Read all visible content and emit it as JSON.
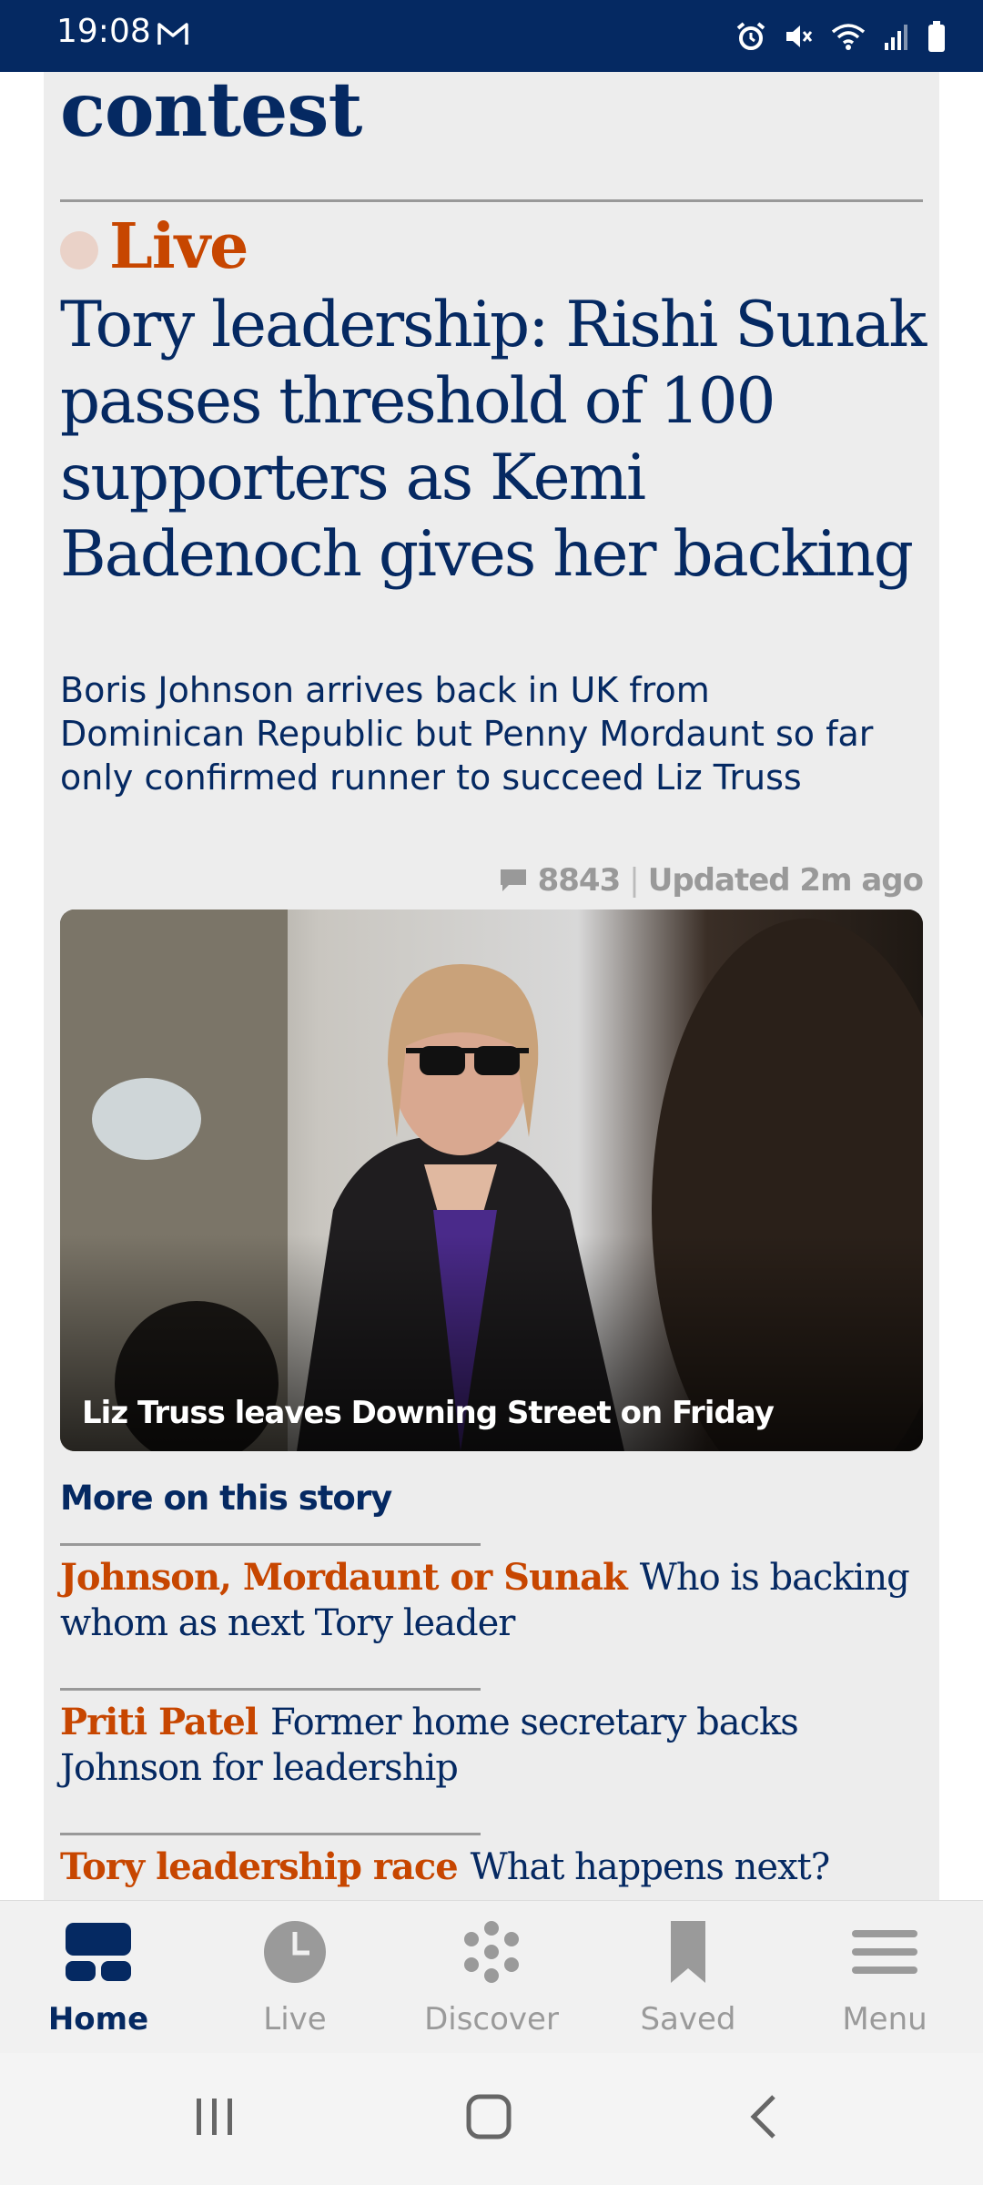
{
  "status_bar": {
    "time": "19:08",
    "icons": [
      "gmail-icon",
      "alarm-icon",
      "mute-icon",
      "wifi-icon",
      "signal-icon",
      "battery-icon"
    ]
  },
  "article": {
    "headline_fragment": "contest",
    "live_label": "Live",
    "headline": "Tory leadership: Rishi Sunak passes threshold of 100 supporters as Kemi Badenoch gives her backing",
    "standfirst": "Boris Johnson arrives back in UK from Dominican Republic but Penny Mordaunt so far only confirmed runner to succeed Liz Truss",
    "comment_count": "8843",
    "separator": "|",
    "updated": "Updated 2m ago",
    "image_caption": "Liz Truss leaves Downing Street on Friday"
  },
  "more_on_story": {
    "title": "More on this story",
    "items": [
      {
        "kicker": "Johnson, Mordaunt or Sunak",
        "text": "Who is backing whom as next Tory leader"
      },
      {
        "kicker": "Priti Patel",
        "text": "Former home secretary backs Johnson for leadership"
      },
      {
        "kicker": "Tory leadership race",
        "text": "What happens next?"
      }
    ]
  },
  "bottom_nav": {
    "items": [
      {
        "label": "Home",
        "icon": "home-icon",
        "active": true
      },
      {
        "label": "Live",
        "icon": "clock-icon",
        "active": false
      },
      {
        "label": "Discover",
        "icon": "discover-icon",
        "active": false
      },
      {
        "label": "Saved",
        "icon": "bookmark-icon",
        "active": false
      },
      {
        "label": "Menu",
        "icon": "menu-icon",
        "active": false
      }
    ]
  },
  "colors": {
    "brand_navy": "#052962",
    "live_orange": "#c74600",
    "card_bg": "#ededed"
  }
}
